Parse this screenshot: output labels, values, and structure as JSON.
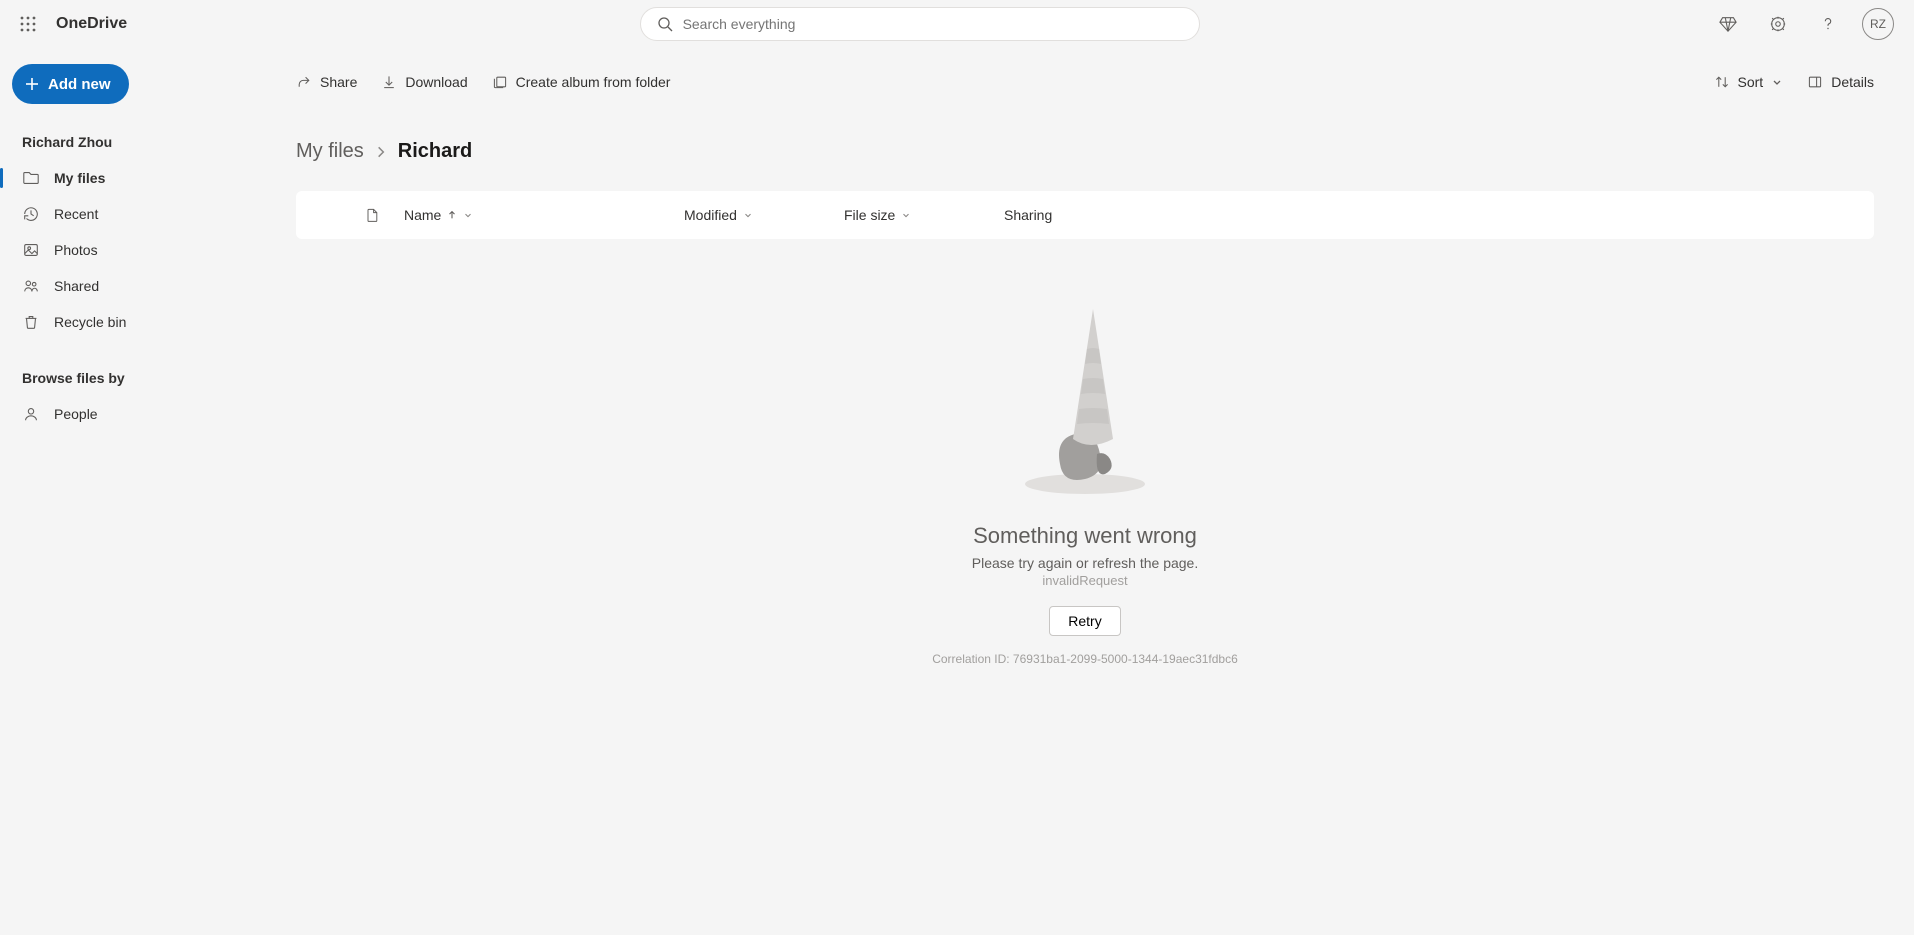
{
  "header": {
    "app_title": "OneDrive",
    "search_placeholder": "Search everything",
    "avatar_initials": "RZ"
  },
  "sidebar": {
    "add_label": "Add new",
    "user_name": "Richard Zhou",
    "items": [
      {
        "label": "My files",
        "icon": "folder",
        "active": true
      },
      {
        "label": "Recent",
        "icon": "recent",
        "active": false
      },
      {
        "label": "Photos",
        "icon": "photos",
        "active": false
      },
      {
        "label": "Shared",
        "icon": "shared",
        "active": false
      },
      {
        "label": "Recycle bin",
        "icon": "recycle",
        "active": false
      }
    ],
    "browse_section": "Browse files by",
    "browse_items": [
      {
        "label": "People",
        "icon": "person"
      }
    ]
  },
  "toolbar": {
    "share_label": "Share",
    "download_label": "Download",
    "album_label": "Create album from folder",
    "sort_label": "Sort",
    "details_label": "Details"
  },
  "breadcrumb": {
    "parent": "My files",
    "current": "Richard"
  },
  "table": {
    "name_header": "Name",
    "modified_header": "Modified",
    "size_header": "File size",
    "sharing_header": "Sharing"
  },
  "error": {
    "title": "Something went wrong",
    "subtitle": "Please try again or refresh the page.",
    "error_code": "invalidRequest",
    "retry_label": "Retry",
    "correlation_prefix": "Correlation ID: ",
    "correlation_id": "76931ba1-2099-5000-1344-19aec31fdbc6"
  }
}
